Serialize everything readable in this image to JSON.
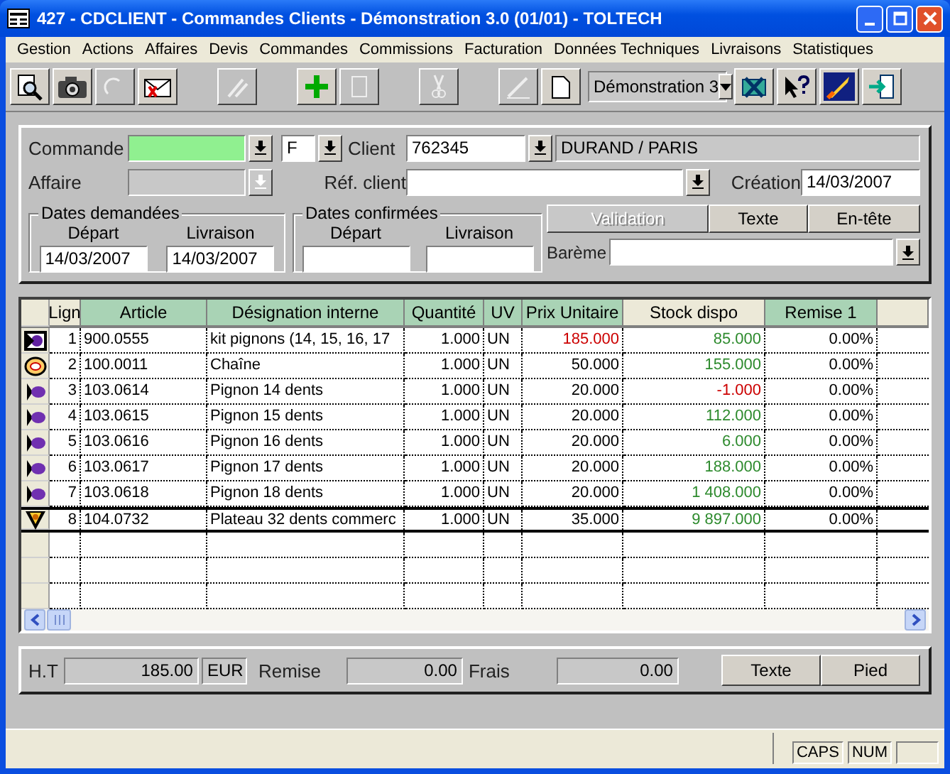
{
  "window": {
    "title": "427 - CDCLIENT - Commandes Clients - Démonstration 3.0 (01/01) - TOLTECH"
  },
  "menu": [
    "Gestion",
    "Actions",
    "Affaires",
    "Devis",
    "Commandes",
    "Commissions",
    "Facturation",
    "Données Techniques",
    "Livraisons",
    "Statistiques"
  ],
  "toolbar": [
    {
      "kind": "button",
      "disabled": false,
      "gap": false
    },
    {
      "kind": "button",
      "disabled": false,
      "gap": false
    },
    {
      "kind": "button",
      "disabled": true,
      "gap": false
    },
    {
      "kind": "button",
      "disabled": false,
      "gap": false
    },
    {
      "kind": "button",
      "disabled": true,
      "gap": true
    },
    {
      "kind": "button",
      "disabled": false,
      "gap": true
    },
    {
      "kind": "button",
      "disabled": true,
      "gap": false
    },
    {
      "kind": "button",
      "disabled": true,
      "gap": true
    },
    {
      "kind": "button",
      "disabled": true,
      "gap": true
    },
    {
      "kind": "button",
      "disabled": false,
      "gap": false
    },
    {
      "kind": "combo",
      "value": "Démonstration 3"
    },
    {
      "kind": "button",
      "disabled": false,
      "gap": false
    },
    {
      "kind": "button",
      "disabled": false,
      "gap": false
    },
    {
      "kind": "button",
      "disabled": false,
      "gap": false
    },
    {
      "kind": "button",
      "disabled": false,
      "gap": false
    }
  ],
  "header": {
    "commande": {
      "label": "Commande",
      "type": "F"
    },
    "client": {
      "label": "Client",
      "code": "762345",
      "name": "DURAND / PARIS"
    },
    "affaire": {
      "label": "Affaire",
      "disabled": true
    },
    "ref_client": {
      "label": "Réf. client"
    },
    "creation": {
      "label": "Création",
      "value": "14/03/2007"
    },
    "dates_demandees": {
      "title": "Dates demandées",
      "depart_label": "Départ",
      "livraison_label": "Livraison",
      "depart": "14/03/2007",
      "livraison": "14/03/2007"
    },
    "dates_confirmees": {
      "title": "Dates confirmées",
      "depart_label": "Départ",
      "livraison_label": "Livraison"
    },
    "buttons": [
      {
        "label": "Validation",
        "disabled": true
      },
      {
        "label": "Texte",
        "disabled": false
      },
      {
        "label": "En-tête",
        "disabled": false
      }
    ],
    "bareme": {
      "label": "Barème"
    }
  },
  "table": {
    "columns": [
      {
        "label": "Lign",
        "color": "#ece9d8"
      },
      {
        "label": "Article",
        "color": "#a9d3b5"
      },
      {
        "label": "Désignation interne",
        "color": "#a9d3b5"
      },
      {
        "label": "Quantité",
        "color": "#a9d3b5"
      },
      {
        "label": "UV",
        "color": "#a9d3b5"
      },
      {
        "label": "Prix Unitaire",
        "color": "#a9d3b5"
      },
      {
        "label": "Stock dispo",
        "color": "#ece9d8"
      },
      {
        "label": "Remise 1",
        "color": "#a9d3b5"
      }
    ],
    "rows": [
      {
        "kind": "kit",
        "selected": false,
        "line": "1",
        "article": "900.0555",
        "designation": "kit pignons (14, 15, 16, 17",
        "quantity": "1.000",
        "uv": "UN",
        "price": {
          "value": "185.000",
          "color": "#cc0000"
        },
        "stock": {
          "value": "85.000",
          "color": "#2e8b2e"
        },
        "discount": "0.00%"
      },
      {
        "kind": "chain",
        "selected": false,
        "line": "2",
        "article": "100.0011",
        "designation": "Chaîne",
        "quantity": "1.000",
        "uv": "UN",
        "price": {
          "value": "50.000",
          "color": "#000000"
        },
        "stock": {
          "value": "155.000",
          "color": "#2e8b2e"
        },
        "discount": "0.00%"
      },
      {
        "kind": "part",
        "selected": false,
        "line": "3",
        "article": "103.0614",
        "designation": "Pignon 14 dents",
        "quantity": "1.000",
        "uv": "UN",
        "price": {
          "value": "20.000",
          "color": "#000000"
        },
        "stock": {
          "value": "-1.000",
          "color": "#cc0000"
        },
        "discount": "0.00%"
      },
      {
        "kind": "part",
        "selected": false,
        "line": "4",
        "article": "103.0615",
        "designation": "Pignon 15 dents",
        "quantity": "1.000",
        "uv": "UN",
        "price": {
          "value": "20.000",
          "color": "#000000"
        },
        "stock": {
          "value": "112.000",
          "color": "#2e8b2e"
        },
        "discount": "0.00%"
      },
      {
        "kind": "part",
        "selected": false,
        "line": "5",
        "article": "103.0616",
        "designation": "Pignon 16 dents",
        "quantity": "1.000",
        "uv": "UN",
        "price": {
          "value": "20.000",
          "color": "#000000"
        },
        "stock": {
          "value": "6.000",
          "color": "#2e8b2e"
        },
        "discount": "0.00%"
      },
      {
        "kind": "part",
        "selected": false,
        "line": "6",
        "article": "103.0617",
        "designation": "Pignon 17 dents",
        "quantity": "1.000",
        "uv": "UN",
        "price": {
          "value": "20.000",
          "color": "#000000"
        },
        "stock": {
          "value": "188.000",
          "color": "#2e8b2e"
        },
        "discount": "0.00%"
      },
      {
        "kind": "part",
        "selected": false,
        "line": "7",
        "article": "103.0618",
        "designation": "Pignon 18 dents",
        "quantity": "1.000",
        "uv": "UN",
        "price": {
          "value": "20.000",
          "color": "#000000"
        },
        "stock": {
          "value": "1 408.000",
          "color": "#2e8b2e"
        },
        "discount": "0.00%"
      },
      {
        "kind": "plate",
        "selected": true,
        "line": "8",
        "article": "104.0732",
        "designation": "Plateau 32 dents commerc",
        "quantity": "1.000",
        "uv": "UN",
        "price": {
          "value": "35.000",
          "color": "#000000"
        },
        "stock": {
          "value": "9 897.000",
          "color": "#2e8b2e"
        },
        "discount": "0.00%"
      }
    ]
  },
  "totals": {
    "ht_label": "H.T",
    "ht": "185.00",
    "currency": "EUR",
    "remise_label": "Remise",
    "remise": "0.00",
    "frais_label": "Frais",
    "frais": "0.00",
    "buttons": [
      "Texte",
      "Pied"
    ]
  },
  "status_bar": {
    "caps": "CAPS",
    "num": "NUM"
  }
}
